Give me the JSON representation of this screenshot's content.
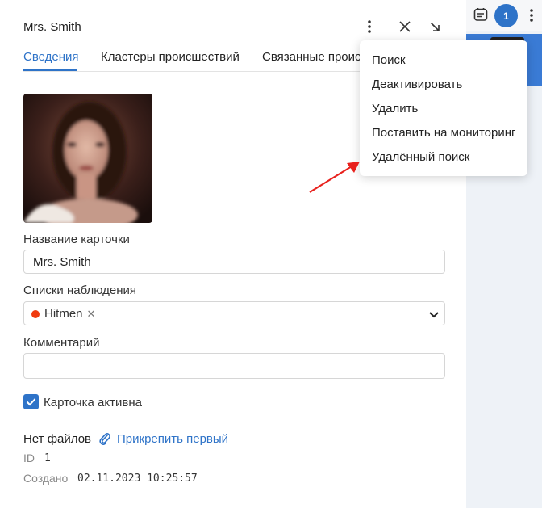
{
  "card": {
    "title": "Mrs. Smith",
    "tabs": [
      {
        "label": "Сведения"
      },
      {
        "label": "Кластеры происшествий"
      },
      {
        "label": "Связанные происшествия"
      }
    ],
    "name_label": "Название карточки",
    "name_value": "Mrs. Smith",
    "watchlists_label": "Списки наблюдения",
    "watchlist_chip": "Hitmen",
    "comment_label": "Комментарий",
    "comment_value": "",
    "active_label": "Карточка активна",
    "no_files": "Нет файлов",
    "attach_first": "Прикрепить первый",
    "id_key": "ID",
    "id_value": "1",
    "created_key": "Создано",
    "created_value": "02.11.2023 10:25:57"
  },
  "menu": {
    "items": [
      {
        "label": "Поиск"
      },
      {
        "label": "Деактивировать"
      },
      {
        "label": "Удалить"
      },
      {
        "label": "Поставить на мониторинг"
      },
      {
        "label": "Удалённый поиск"
      }
    ]
  },
  "right_panel": {
    "badge_count": "1"
  },
  "colors": {
    "accent": "#2e73c8",
    "chip_dot": "#f03a0e",
    "arrow": "#e8201c"
  },
  "icons": {
    "more": "more-vertical-icon",
    "close": "close-icon",
    "collapse": "arrow-down-right-icon",
    "chevron": "chevron-down-icon",
    "check": "check-icon",
    "attach": "paperclip-icon",
    "notes": "notes-icon"
  }
}
